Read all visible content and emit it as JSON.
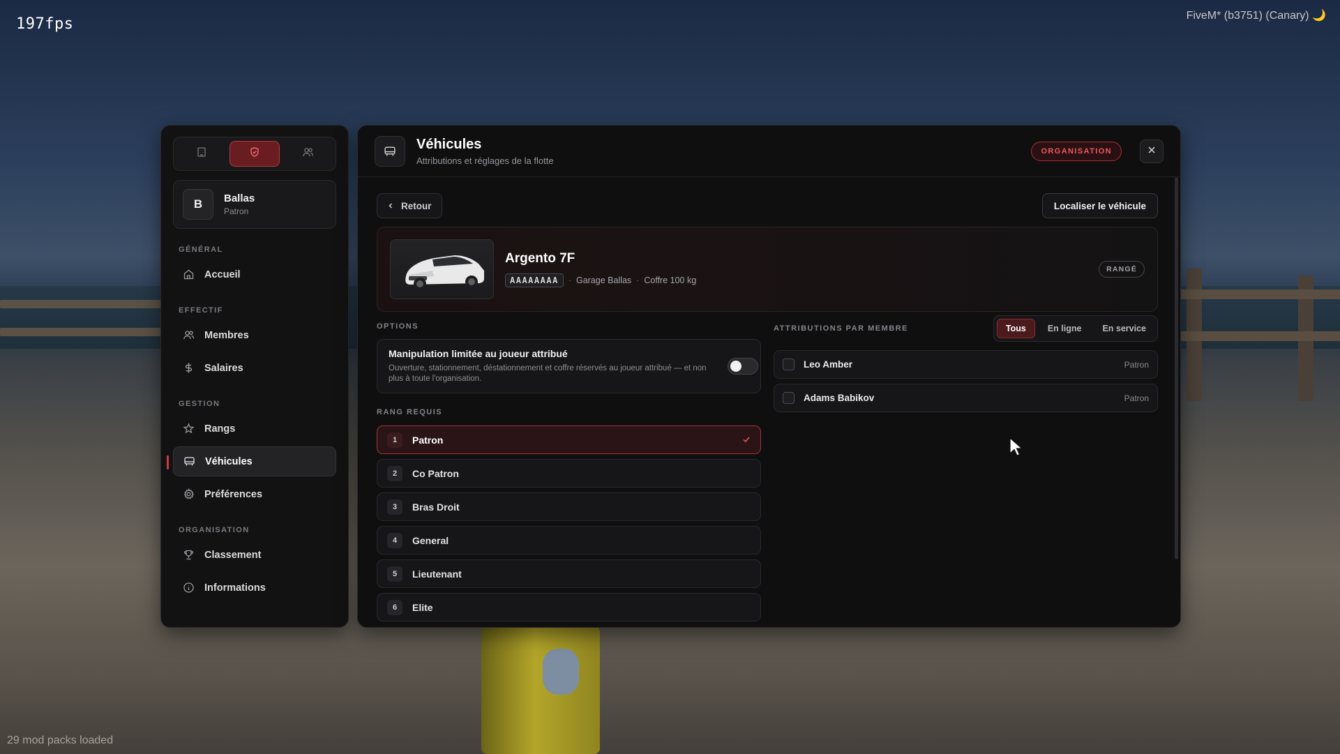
{
  "overlay": {
    "fps": "197fps",
    "build": "FiveM* (b3751) (Canary) 🌙",
    "modpacks": "29 mod packs loaded"
  },
  "sidebar": {
    "tabs": [
      {
        "icon": "building-icon"
      },
      {
        "icon": "shield-icon",
        "active": true
      },
      {
        "icon": "users-icon"
      }
    ],
    "profile": {
      "initial": "B",
      "name": "Ballas",
      "role": "Patron"
    },
    "sections": {
      "general": "GÉNÉRAL",
      "effectif": "EFFECTIF",
      "gestion": "GESTION",
      "organisation": "ORGANISATION"
    },
    "items": {
      "accueil": "Accueil",
      "membres": "Membres",
      "salaires": "Salaires",
      "rangs": "Rangs",
      "vehicules": "Véhicules",
      "preferences": "Préférences",
      "classement": "Classement",
      "informations": "Informations"
    }
  },
  "header": {
    "title": "Véhicules",
    "subtitle": "Attributions et réglages de la flotte",
    "badge": "ORGANISATION"
  },
  "toolbar": {
    "back": "Retour",
    "locate": "Localiser le véhicule"
  },
  "vehicle": {
    "name": "Argento 7F",
    "plate": "AAAAAAAA",
    "garage": "Garage Ballas",
    "trunk": "Coffre 100 kg",
    "status": "RANGÉ"
  },
  "options": {
    "heading": "OPTIONS",
    "title": "Manipulation limitée au joueur attribué",
    "description": "Ouverture, stationnement, déstationnement et coffre réservés au joueur attribué — et non plus à toute l'organisation.",
    "toggle_on": false
  },
  "ranks": {
    "heading": "RANG REQUIS",
    "items": [
      {
        "num": "1",
        "name": "Patron",
        "selected": true
      },
      {
        "num": "2",
        "name": "Co Patron"
      },
      {
        "num": "3",
        "name": "Bras Droit"
      },
      {
        "num": "4",
        "name": "General"
      },
      {
        "num": "5",
        "name": "Lieutenant"
      },
      {
        "num": "6",
        "name": "Elite"
      }
    ]
  },
  "attributions": {
    "heading": "ATTRIBUTIONS PAR MEMBRE",
    "filters": [
      "Tous",
      "En ligne",
      "En service"
    ],
    "active_filter": "Tous",
    "members": [
      {
        "name": "Leo Amber",
        "role": "Patron"
      },
      {
        "name": "Adams Babikov",
        "role": "Patron"
      }
    ]
  },
  "colors": {
    "accent": "#d33a40",
    "panel": "#0f0f10"
  }
}
